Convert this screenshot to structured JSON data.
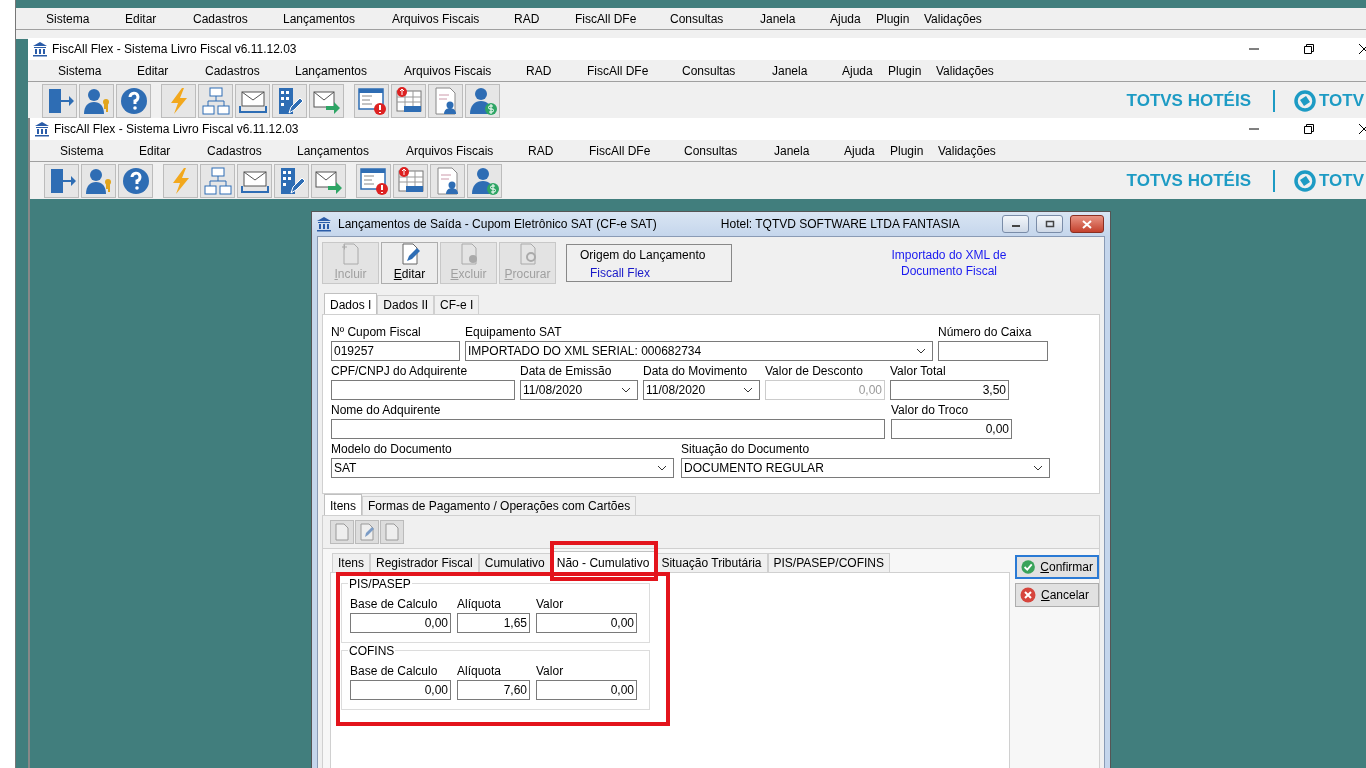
{
  "windows": [
    {
      "menu": [
        "Sistema",
        "Editar",
        "Cadastros",
        "Lançamentos",
        "Arquivos Fiscais",
        "RAD",
        "FiscAll DFe",
        "Consultas",
        "Janela",
        "Ajuda",
        "Plugin",
        "Validações"
      ]
    },
    {
      "title": "FiscAll Flex - Sistema Livro Fiscal v6.11.12.03",
      "menu": [
        "Sistema",
        "Editar",
        "Cadastros",
        "Lançamentos",
        "Arquivos Fiscais",
        "RAD",
        "FiscAll DFe",
        "Consultas",
        "Janela",
        "Ajuda",
        "Plugin",
        "Validações"
      ],
      "brand": "TOTVS HOTÉIS",
      "brand_cut": "TOTV"
    },
    {
      "title": "FiscAll Flex - Sistema Livro Fiscal v6.11.12.03",
      "menu": [
        "Sistema",
        "Editar",
        "Cadastros",
        "Lançamentos",
        "Arquivos Fiscais",
        "RAD",
        "FiscAll DFe",
        "Consultas",
        "Janela",
        "Ajuda",
        "Plugin",
        "Validações"
      ],
      "brand": "TOTVS HOTÉIS",
      "brand_cut": "TOTV"
    }
  ],
  "dialog": {
    "title": "Lançamentos de Saída - Cupom Eletrônico SAT (CF-e SAT)",
    "hotel": "Hotel: TQTVD SOFTWARE LTDA FANTASIA",
    "toolbar": [
      {
        "label": "Incluir",
        "disabled": true
      },
      {
        "label": "Editar",
        "disabled": false
      },
      {
        "label": "Excluir",
        "disabled": true
      },
      {
        "label": "Procurar",
        "disabled": true
      }
    ],
    "origin": {
      "label": "Origem do Lançamento",
      "value": "Fiscall Flex"
    },
    "note": "Importado do XML de Documento Fiscal",
    "tabs": [
      {
        "label": "Dados I",
        "selected": true
      },
      {
        "label": "Dados II",
        "selected": false
      },
      {
        "label": "CF-e I",
        "selected": false
      }
    ],
    "rows": [
      {
        "fields": [
          {
            "label": "Nº Cupom Fiscal",
            "value": "019257",
            "kind": "text",
            "disabled": false
          },
          {
            "label": "Equipamento SAT",
            "value": "IMPORTADO DO XML SERIAL: 000682734",
            "kind": "combo",
            "disabled": false
          },
          {
            "label": "Número do Caixa",
            "kind": "text",
            "disabled": false
          }
        ]
      },
      {
        "fields": [
          {
            "label": "CPF/CNPJ do Adquirente",
            "kind": "text",
            "disabled": false
          },
          {
            "label": "Data de Emissão",
            "value": "11/08/2020",
            "kind": "combo",
            "disabled": false
          },
          {
            "label": "Data do Movimento",
            "value": "11/08/2020",
            "kind": "combo",
            "disabled": false
          },
          {
            "label": "Valor de Desconto",
            "value": "0,00",
            "kind": "number",
            "disabled": true
          },
          {
            "label": "Valor Total",
            "value": "3,50",
            "kind": "number",
            "disabled": false
          }
        ]
      },
      {
        "fields": [
          {
            "label": "Nome do Adquirente",
            "kind": "text",
            "disabled": false
          },
          {
            "label": "Valor do Troco",
            "value": "0,00",
            "kind": "number",
            "disabled": false
          }
        ]
      },
      {
        "fields": [
          {
            "label": "Modelo do Documento",
            "value": "SAT",
            "kind": "combo",
            "disabled": false
          },
          {
            "label": "Situação do Documento",
            "value": "DOCUMENTO REGULAR",
            "kind": "combo",
            "disabled": false
          }
        ]
      }
    ],
    "lower_tabs": [
      {
        "label": "Itens",
        "selected": true
      },
      {
        "label": "Formas de Pagamento / Operações com Cartões",
        "selected": false
      }
    ],
    "inner_tabs": [
      {
        "label": "Itens",
        "selected": false
      },
      {
        "label": "Registrador Fiscal",
        "selected": false
      },
      {
        "label": "Cumulativo",
        "selected": false
      },
      {
        "label": "Não - Cumulativo",
        "selected": true
      },
      {
        "label": "Situação Tributária",
        "selected": false
      },
      {
        "label": "PIS/PASEP/COFINS",
        "selected": false
      }
    ],
    "groups": [
      {
        "title": "PIS/PASEP",
        "fields": [
          {
            "label": "Base de Calculo",
            "value": "0,00"
          },
          {
            "label": "Alíquota",
            "value": "1,65"
          },
          {
            "label": "Valor",
            "value": "0,00"
          }
        ]
      },
      {
        "title": "COFINS",
        "fields": [
          {
            "label": "Base de Calculo",
            "value": "0,00"
          },
          {
            "label": "Alíquota",
            "value": "7,60"
          },
          {
            "label": "Valor",
            "value": "0,00"
          }
        ]
      }
    ],
    "buttons": [
      {
        "label": "Confirmar",
        "kind": "confirm",
        "focused": true
      },
      {
        "label": "Cancelar",
        "kind": "cancel",
        "focused": false
      }
    ]
  }
}
